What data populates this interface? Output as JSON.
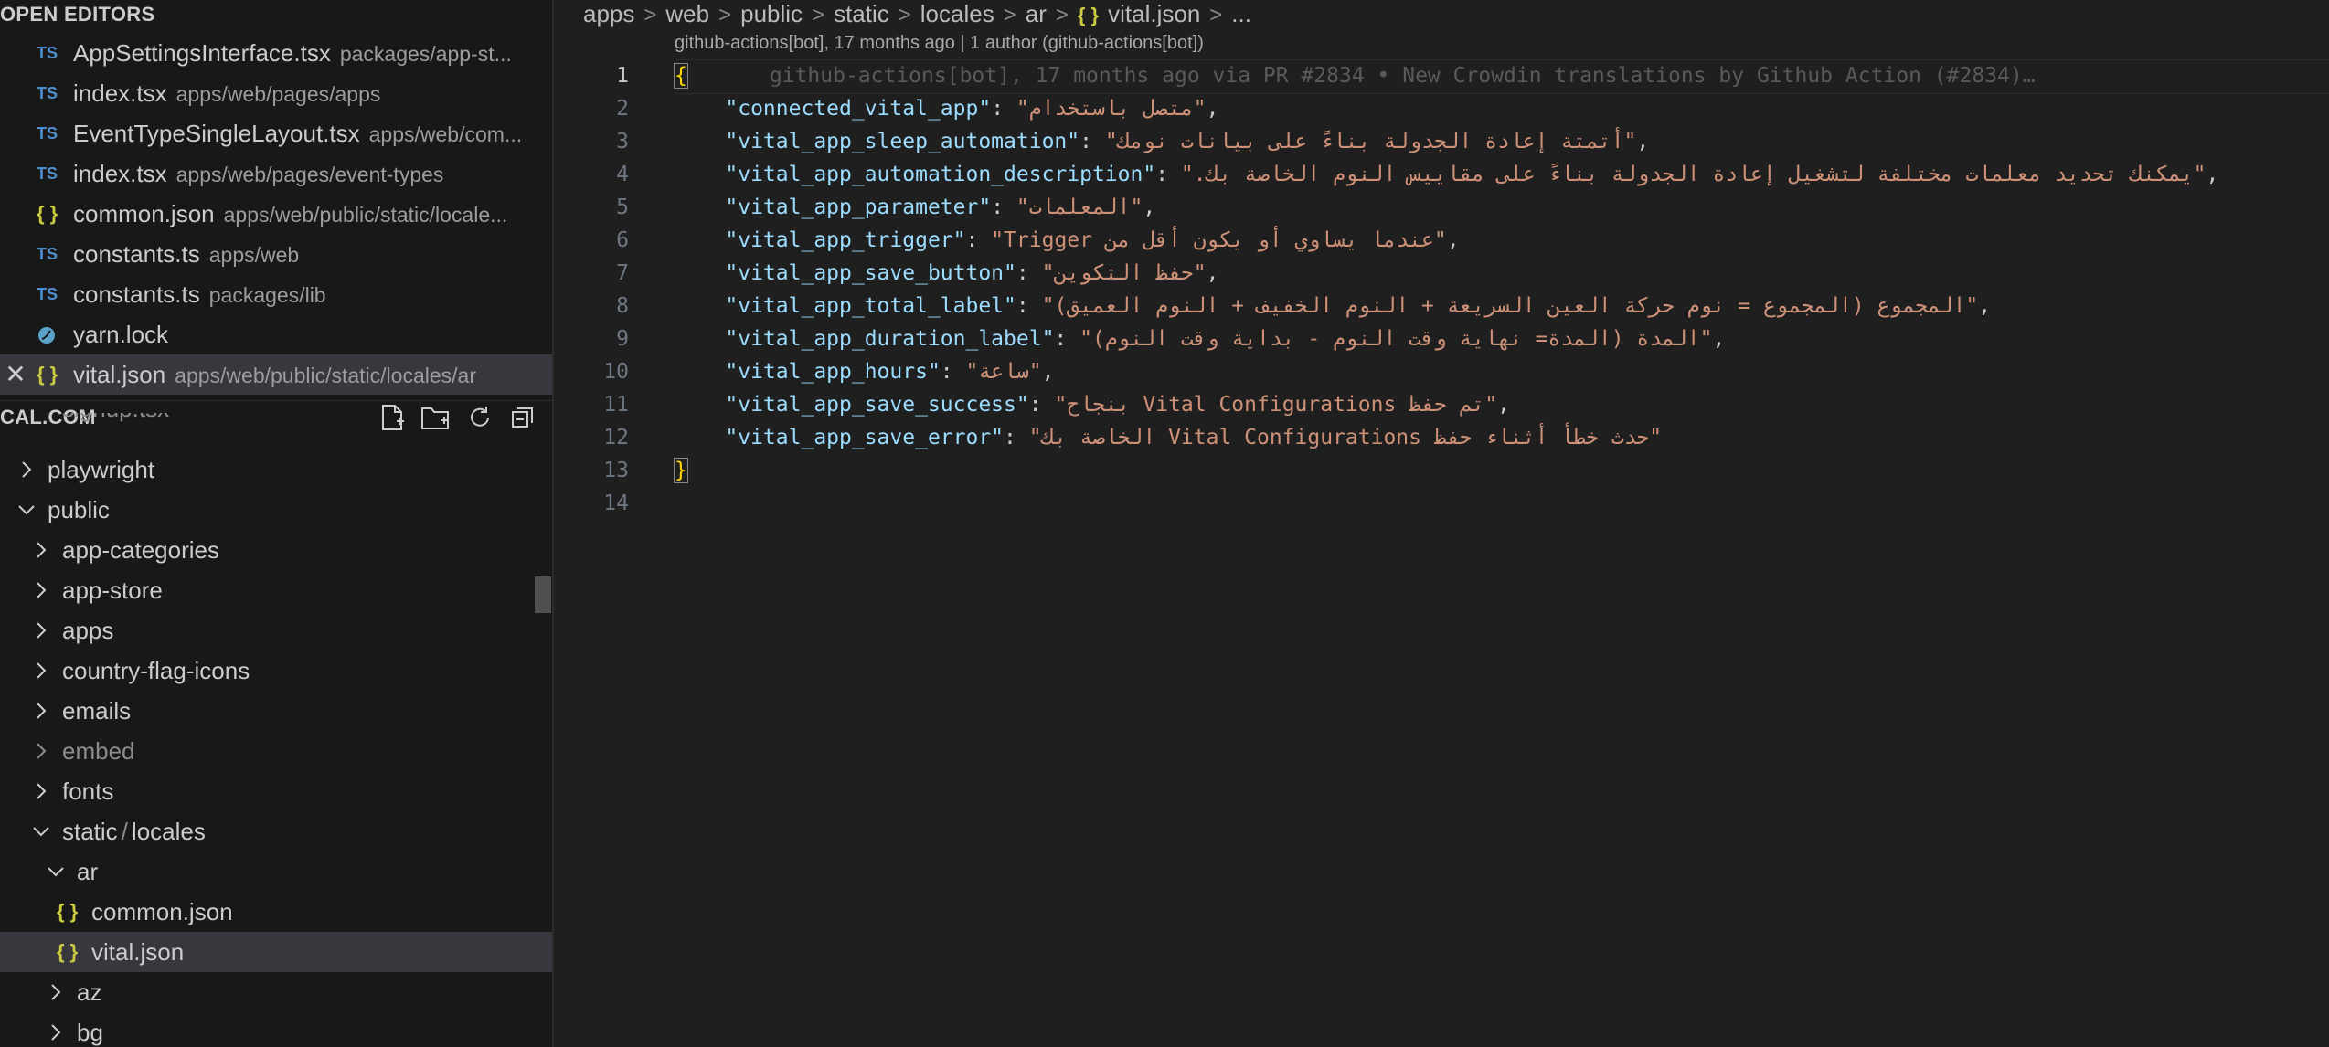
{
  "sidebar": {
    "open_editors_title": "OPEN EDITORS",
    "open_editors": [
      {
        "name": "AppSettingsInterface.tsx",
        "path": "packages/app-st...",
        "icon": "typescript-icon",
        "icon_text": "TS"
      },
      {
        "name": "index.tsx",
        "path": "apps/web/pages/apps",
        "icon": "typescript-icon",
        "icon_text": "TS"
      },
      {
        "name": "EventTypeSingleLayout.tsx",
        "path": "apps/web/com...",
        "icon": "typescript-icon",
        "icon_text": "TS"
      },
      {
        "name": "index.tsx",
        "path": "apps/web/pages/event-types",
        "icon": "typescript-icon",
        "icon_text": "TS"
      },
      {
        "name": "common.json",
        "path": "apps/web/public/static/locale...",
        "icon": "json-icon",
        "icon_text": "{ }"
      },
      {
        "name": "constants.ts",
        "path": "apps/web",
        "icon": "typescript-icon",
        "icon_text": "TS"
      },
      {
        "name": "constants.ts",
        "path": "packages/lib",
        "icon": "typescript-icon",
        "icon_text": "TS"
      },
      {
        "name": "yarn.lock",
        "path": "",
        "icon": "yarn-icon",
        "icon_text": ""
      },
      {
        "name": "vital.json",
        "path": "apps/web/public/static/locales/ar",
        "icon": "json-icon",
        "icon_text": "{ }",
        "active": true
      }
    ],
    "close_glyph": "✕",
    "project_title": "CAL.COM",
    "tree": {
      "partial_item": "signup.tsx",
      "playwright": "playwright",
      "public": "public",
      "app_categories": "app-categories",
      "app_store": "app-store",
      "apps": "apps",
      "country_flag_icons": "country-flag-icons",
      "emails": "emails",
      "embed": "embed",
      "fonts": "fonts",
      "static": "static",
      "locales": "locales",
      "ar": "ar",
      "common_json": "common.json",
      "vital_json": "vital.json",
      "az": "az",
      "bg": "bg",
      "json_icon_text": "{ }",
      "path_sep": "/"
    }
  },
  "editor": {
    "breadcrumb": [
      "apps",
      "web",
      "public",
      "static",
      "locales",
      "ar"
    ],
    "breadcrumb_json_icon": "{ }",
    "breadcrumb_file": "vital.json",
    "breadcrumb_more": "...",
    "breadcrumb_sep": ">",
    "codelens": "github-actions[bot], 17 months ago | 1 author (github-actions[bot])",
    "line_numbers": [
      "1",
      "2",
      "3",
      "4",
      "5",
      "6",
      "7",
      "8",
      "9",
      "10",
      "11",
      "12",
      "13",
      "14"
    ],
    "open_brace": "{",
    "close_brace": "}",
    "blame_inline": "github-actions[bot], 17 months ago via PR #2834 • New Crowdin translations by Github Action (#2834)…",
    "entries": [
      {
        "key": "\"connected_vital_app\"",
        "value": "\"متصل باستخدام\"",
        "sep": ","
      },
      {
        "key": "\"vital_app_sleep_automation\"",
        "value": "\"أتمتة إعادة الجدولة بناءً على بيانات نومك\"",
        "sep": ","
      },
      {
        "key": "\"vital_app_automation_description\"",
        "value": "\"يمكنك تحديد معلمات مختلفة لتشغيل إعادة الجدولة بناءً على مقاييس النوم الخاصة بك.\"",
        "sep": ","
      },
      {
        "key": "\"vital_app_parameter\"",
        "value": "\"المعلمات\"",
        "sep": ","
      },
      {
        "key": "\"vital_app_trigger\"",
        "value": "\"Trigger عندما يساوي أو يكون أقل من\"",
        "sep": ","
      },
      {
        "key": "\"vital_app_save_button\"",
        "value": "\"حفظ التكوين\"",
        "sep": ","
      },
      {
        "key": "\"vital_app_total_label\"",
        "value": "\"المجموع (المجموع = نوم حركة العين السريعة + النوم الخفيف + النوم العميق)\"",
        "sep": ","
      },
      {
        "key": "\"vital_app_duration_label\"",
        "value": "\"المدة (المدة= نهاية وقت النوم - بداية وقت النوم)\"",
        "sep": ","
      },
      {
        "key": "\"vital_app_hours\"",
        "value": "\"ساعة\"",
        "sep": ","
      },
      {
        "key": "\"vital_app_save_success\"",
        "value": "\"تم حفظ Vital Configurations بنجاح\"",
        "sep": ","
      },
      {
        "key": "\"vital_app_save_error\"",
        "value": "\"حدث خطأ أثناء حفظ Vital Configurations الخاصة بك\"",
        "sep": ""
      }
    ],
    "colon": ": "
  },
  "colors": {
    "background": "#1f1f1f",
    "sidebar": "#181818",
    "json_key": "#9cdcfe",
    "json_string": "#ce9178",
    "brace": "#ffd700",
    "ts_icon": "#4d8fcc",
    "json_icon": "#cbcb41"
  }
}
